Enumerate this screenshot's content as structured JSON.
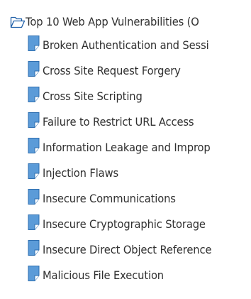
{
  "tree": {
    "root": {
      "label": "Top 10 Web App Vulnerabilities (O",
      "icon": "open-folder-icon"
    },
    "items": [
      {
        "label": "Broken Authentication and Sessi",
        "icon": "document-icon"
      },
      {
        "label": "Cross Site Request Forgery",
        "icon": "document-icon"
      },
      {
        "label": "Cross Site Scripting",
        "icon": "document-icon"
      },
      {
        "label": "Failure to Restrict URL Access",
        "icon": "document-icon"
      },
      {
        "label": "Information Leakage and Improp",
        "icon": "document-icon"
      },
      {
        "label": "Injection Flaws",
        "icon": "document-icon"
      },
      {
        "label": "Insecure Communications",
        "icon": "document-icon"
      },
      {
        "label": "Insecure Cryptographic Storage",
        "icon": "document-icon"
      },
      {
        "label": "Insecure Direct Object Reference",
        "icon": "document-icon"
      },
      {
        "label": "Malicious File Execution",
        "icon": "document-icon"
      }
    ]
  },
  "colors": {
    "text": "#303030",
    "icon_fill": "#5b9bd8",
    "icon_stroke": "#2f6fb0",
    "folder_stroke": "#1f5fa8",
    "background": "#ffffff"
  }
}
